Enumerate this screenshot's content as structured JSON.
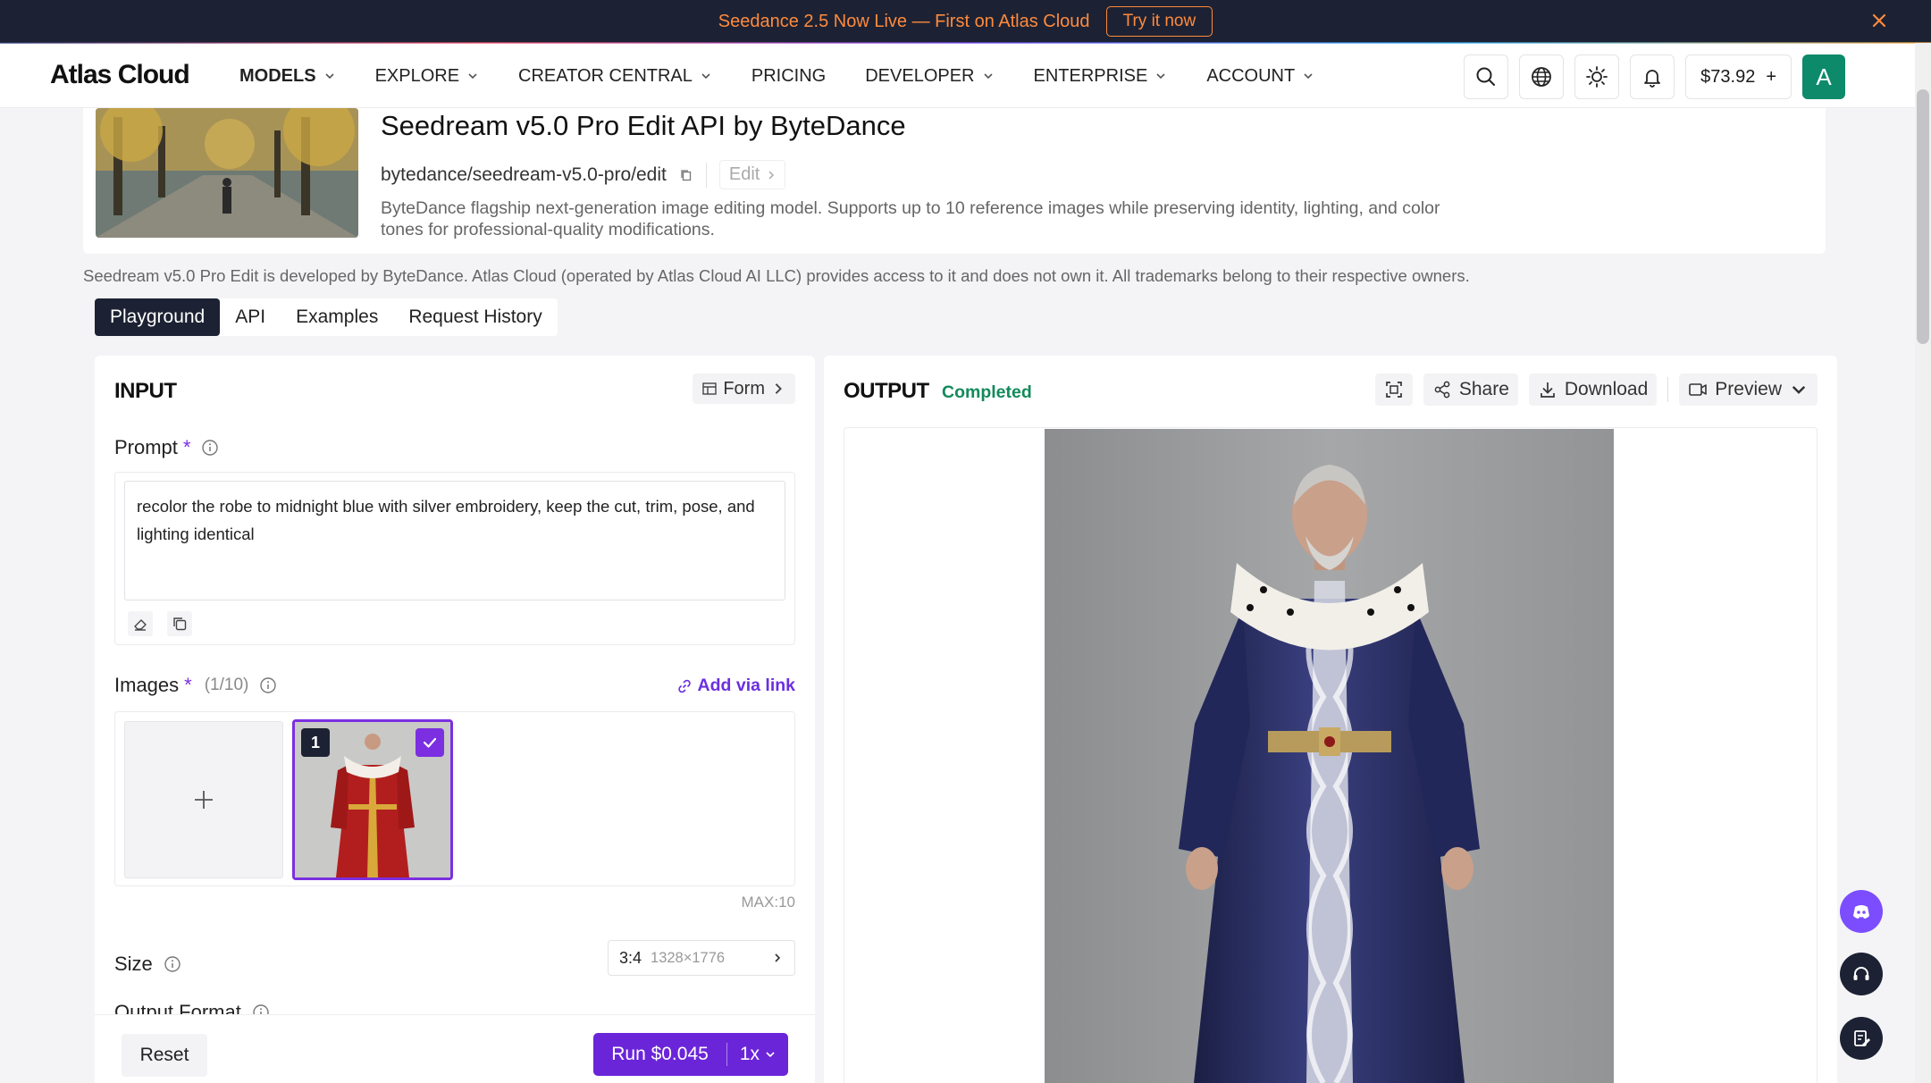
{
  "banner": {
    "text": "Seedance 2.5 Now Live — First on Atlas Cloud",
    "cta": "Try it now",
    "close_icon": "close-icon",
    "accent": "#ff8a3d"
  },
  "nav": {
    "logo": "Atlas Cloud",
    "menu": [
      {
        "label": "MODELS",
        "active": true
      },
      {
        "label": "EXPLORE"
      },
      {
        "label": "CREATOR CENTRAL"
      },
      {
        "label": "PRICING"
      },
      {
        "label": "DEVELOPER"
      },
      {
        "label": "ENTERPRISE"
      },
      {
        "label": "ACCOUNT"
      }
    ],
    "icons": [
      "search-icon",
      "globe-icon",
      "sun-icon",
      "bell-icon"
    ],
    "balance": "$73.92",
    "balance_add": "+",
    "avatar": "A"
  },
  "model": {
    "title": "Seedream v5.0 Pro Edit API by ByteDance",
    "slug": "bytedance/seedream-v5.0-pro/edit",
    "edit_label": "Edit",
    "description": "ByteDance flagship next-generation image editing model. Supports up to 10 reference images while preserving identity, lighting, and color tones for professional-quality modifications."
  },
  "disclaimer": "Seedream v5.0 Pro Edit is developed by ByteDance. Atlas Cloud (operated by Atlas Cloud AI LLC) provides access to it and does not own it. All trademarks belong to their respective owners.",
  "tabs": [
    {
      "label": "Playground",
      "active": true
    },
    {
      "label": "API"
    },
    {
      "label": "Examples"
    },
    {
      "label": "Request History"
    }
  ],
  "input": {
    "title": "INPUT",
    "form_label": "Form",
    "prompt_label": "Prompt",
    "required_mark": "*",
    "prompt_value": "recolor the robe to midnight blue with silver embroidery, keep the cut, trim, pose, and lighting identical",
    "images_label": "Images",
    "images_count": "(1/10)",
    "add_via_link": "Add via link",
    "image_index": "1",
    "max_label": "MAX:10",
    "size_label": "Size",
    "size_ratio": "3:4",
    "size_dims": "1328×1776",
    "output_format_label": "Output Format",
    "reset_label": "Reset",
    "run_label": "Run $0.045",
    "run_multiplier": "1x"
  },
  "output": {
    "title": "OUTPUT",
    "status": "Completed",
    "status_color": "#138a5c",
    "share_label": "Share",
    "download_label": "Download",
    "preview_label": "Preview"
  },
  "colors": {
    "accent": "#6b25d9",
    "dark": "#1c2233"
  }
}
